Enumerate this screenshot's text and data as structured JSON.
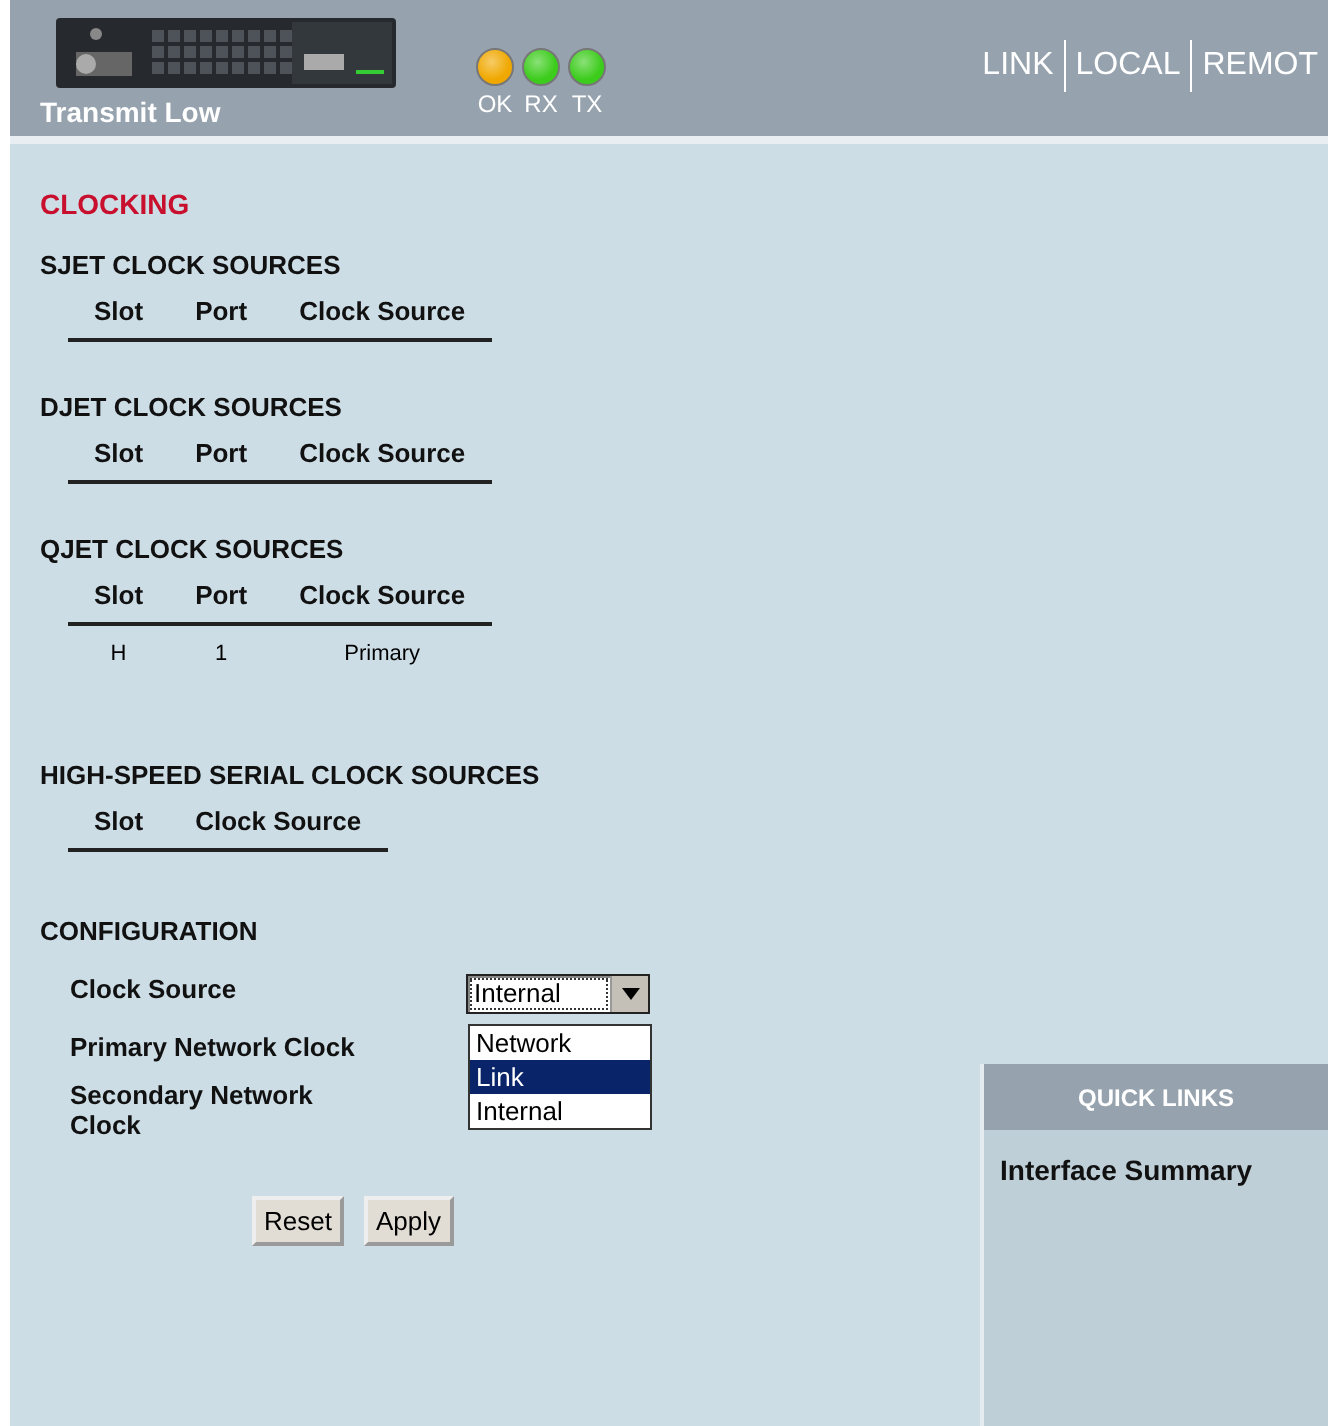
{
  "header": {
    "status": "Transmit Low",
    "leds": [
      {
        "label": "OK",
        "color": "#f0a800"
      },
      {
        "label": "RX",
        "color": "#3ccc1c"
      },
      {
        "label": "TX",
        "color": "#3ccc1c"
      }
    ],
    "nav": [
      "LINK",
      "LOCAL",
      "REMOT"
    ]
  },
  "title": "CLOCKING",
  "sections": [
    {
      "title": "SJET CLOCK SOURCES",
      "columns": [
        "Slot",
        "Port",
        "Clock Source"
      ]
    },
    {
      "title": "DJET CLOCK SOURCES",
      "columns": [
        "Slot",
        "Port",
        "Clock Source"
      ]
    },
    {
      "title": "QJET CLOCK SOURCES",
      "columns": [
        "Slot",
        "Port",
        "Clock Source"
      ],
      "rows": [
        [
          "H",
          "1",
          "Primary"
        ]
      ]
    },
    {
      "title": "HIGH-SPEED SERIAL CLOCK SOURCES",
      "columns": [
        "Slot",
        "Clock Source"
      ]
    }
  ],
  "configuration": {
    "title": "CONFIGURATION",
    "fields": [
      {
        "label": "Clock Source",
        "value": "Internal",
        "expanded": true,
        "options": [
          {
            "label": "Network",
            "highlighted": false
          },
          {
            "label": "Link",
            "highlighted": true
          },
          {
            "label": "Internal",
            "highlighted": false
          }
        ]
      },
      {
        "label": "Primary Network Clock"
      },
      {
        "label": "Secondary Network Clock"
      }
    ],
    "buttons": [
      "Reset",
      "Apply"
    ]
  },
  "quick_links": {
    "title": "QUICK LINKS",
    "items": [
      "Interface Summary"
    ]
  }
}
